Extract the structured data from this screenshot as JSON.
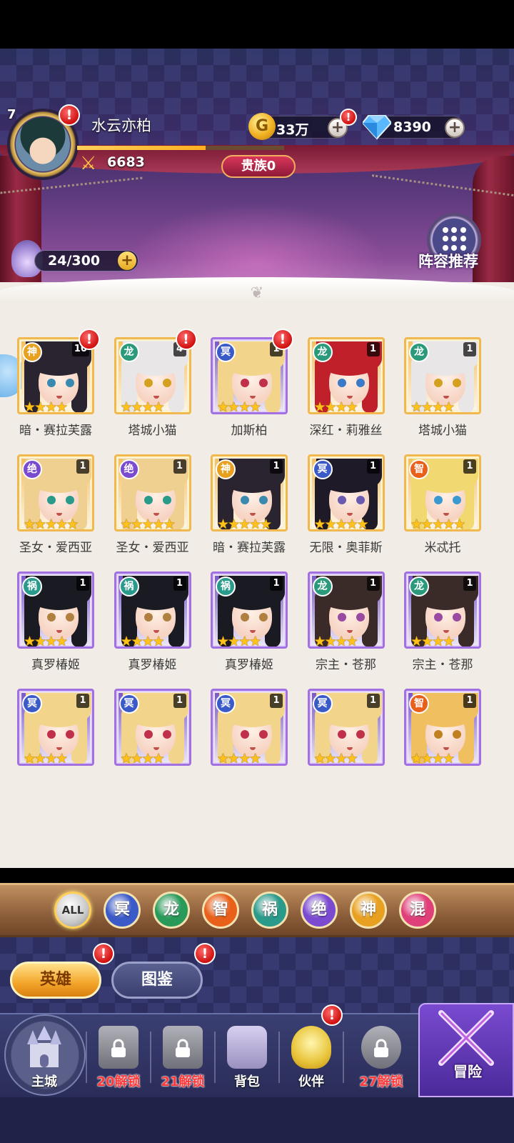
{
  "player": {
    "name": "水云亦柏",
    "level": "7",
    "power": "6683",
    "xp_progress": 0.62
  },
  "currency": {
    "gold": "33万",
    "diamonds": "8390"
  },
  "noble_label": "贵族0",
  "stamina": "24/300",
  "lineup_label": "阵容推荐",
  "heroes": [
    {
      "faction": "神",
      "count": "10",
      "alert": "!",
      "name": "暗・赛拉芙露",
      "stars": "★★★★",
      "frame": "gold",
      "hair": "#2a2430",
      "eye": "#3a8ab0"
    },
    {
      "faction": "龙",
      "count": "4",
      "alert": "!",
      "name": "塔城小猫",
      "stars": "★★★★",
      "frame": "gold",
      "hair": "#e8e6e6",
      "eye": "#d4a020"
    },
    {
      "faction": "冥",
      "count": "1",
      "alert": "!",
      "name": "加斯柏",
      "stars": "★★★★",
      "frame": "purple",
      "hair": "#f2d48a",
      "eye": "#c0304a"
    },
    {
      "faction": "龙",
      "count": "1",
      "alert": "",
      "name": "深红・莉雅丝",
      "stars": "★★★★",
      "frame": "gold",
      "hair": "#c0202a",
      "eye": "#3a7ac8"
    },
    {
      "faction": "龙",
      "count": "1",
      "alert": "",
      "name": "塔城小猫",
      "stars": "★★★★",
      "frame": "gold",
      "hair": "#e8e6e6",
      "eye": "#d4a020"
    },
    {
      "faction": "绝",
      "count": "1",
      "alert": "",
      "name": "圣女・爱西亚",
      "stars": "★★★★★",
      "frame": "gold",
      "hair": "#f0d090",
      "eye": "#2a9a8a"
    },
    {
      "faction": "绝",
      "count": "1",
      "alert": "",
      "name": "圣女・爱西亚",
      "stars": "★★★★★",
      "frame": "gold",
      "hair": "#f0d090",
      "eye": "#2a9a8a"
    },
    {
      "faction": "神",
      "count": "1",
      "alert": "",
      "name": "暗・赛拉芙露",
      "stars": "★★★★★",
      "frame": "gold",
      "hair": "#2a2430",
      "eye": "#3a8ab0"
    },
    {
      "faction": "冥",
      "count": "1",
      "alert": "",
      "name": "无限・奥菲斯",
      "stars": "★★★★★",
      "frame": "gold",
      "hair": "#1e1a28",
      "eye": "#6a5ab0"
    },
    {
      "faction": "智",
      "count": "1",
      "alert": "",
      "name": "米忒托",
      "stars": "★★★★★",
      "frame": "gold",
      "hair": "#f2d870",
      "eye": "#3a9ad0"
    },
    {
      "faction": "祸",
      "count": "1",
      "alert": "",
      "name": "真罗椿姬",
      "stars": "★★★★",
      "frame": "purple",
      "hair": "#1a1a22",
      "eye": "#b08040"
    },
    {
      "faction": "祸",
      "count": "1",
      "alert": "",
      "name": "真罗椿姬",
      "stars": "★★★★",
      "frame": "purple",
      "hair": "#1a1a22",
      "eye": "#b08040"
    },
    {
      "faction": "祸",
      "count": "1",
      "alert": "",
      "name": "真罗椿姬",
      "stars": "★★★★",
      "frame": "purple",
      "hair": "#1a1a22",
      "eye": "#b08040"
    },
    {
      "faction": "龙",
      "count": "1",
      "alert": "",
      "name": "宗主・苍那",
      "stars": "★★★★",
      "frame": "purple",
      "hair": "#3a2a28",
      "eye": "#9a4aa0"
    },
    {
      "faction": "龙",
      "count": "1",
      "alert": "",
      "name": "宗主・苍那",
      "stars": "★★★★",
      "frame": "purple",
      "hair": "#3a2a28",
      "eye": "#9a4aa0"
    },
    {
      "faction": "冥",
      "count": "1",
      "alert": "",
      "name": "",
      "stars": "★★★★",
      "frame": "purple",
      "hair": "#f2d48a",
      "eye": "#c0304a"
    },
    {
      "faction": "冥",
      "count": "1",
      "alert": "",
      "name": "",
      "stars": "★★★★",
      "frame": "purple",
      "hair": "#f2d48a",
      "eye": "#c0304a"
    },
    {
      "faction": "冥",
      "count": "1",
      "alert": "",
      "name": "",
      "stars": "★★★★",
      "frame": "purple",
      "hair": "#f2d48a",
      "eye": "#c0304a"
    },
    {
      "faction": "冥",
      "count": "1",
      "alert": "",
      "name": "",
      "stars": "★★★★",
      "frame": "purple",
      "hair": "#f2d48a",
      "eye": "#c0304a"
    },
    {
      "faction": "智",
      "count": "1",
      "alert": "",
      "name": "",
      "stars": "★★★★",
      "frame": "purple",
      "hair": "#f0c060",
      "eye": "#c08020"
    }
  ],
  "faction_colors": {
    "神": "#e8a020",
    "龙": "#2a9a7a",
    "冥": "#3a5ac8",
    "绝": "#7a4ad0",
    "智": "#e8601a",
    "祸": "#2a9a8a",
    "混": "#e0407a"
  },
  "filters": [
    {
      "label": "ALL",
      "color": "#bbbbbb"
    },
    {
      "label": "冥",
      "color": "#3a5ac8"
    },
    {
      "label": "龙",
      "color": "#2a9a5a"
    },
    {
      "label": "智",
      "color": "#e8601a"
    },
    {
      "label": "祸",
      "color": "#2a9a8a"
    },
    {
      "label": "绝",
      "color": "#7a4ad0"
    },
    {
      "label": "神",
      "color": "#e8a020"
    },
    {
      "label": "混",
      "color": "#e0407a"
    }
  ],
  "tabs": {
    "heroes": "英雄",
    "codex": "图鉴"
  },
  "nav": {
    "home": "主城",
    "locked1": "20解锁",
    "locked2": "21解锁",
    "bag": "背包",
    "partner": "伙伴",
    "locked3": "27解锁",
    "adventure": "冒险"
  },
  "alert_mark": "!"
}
